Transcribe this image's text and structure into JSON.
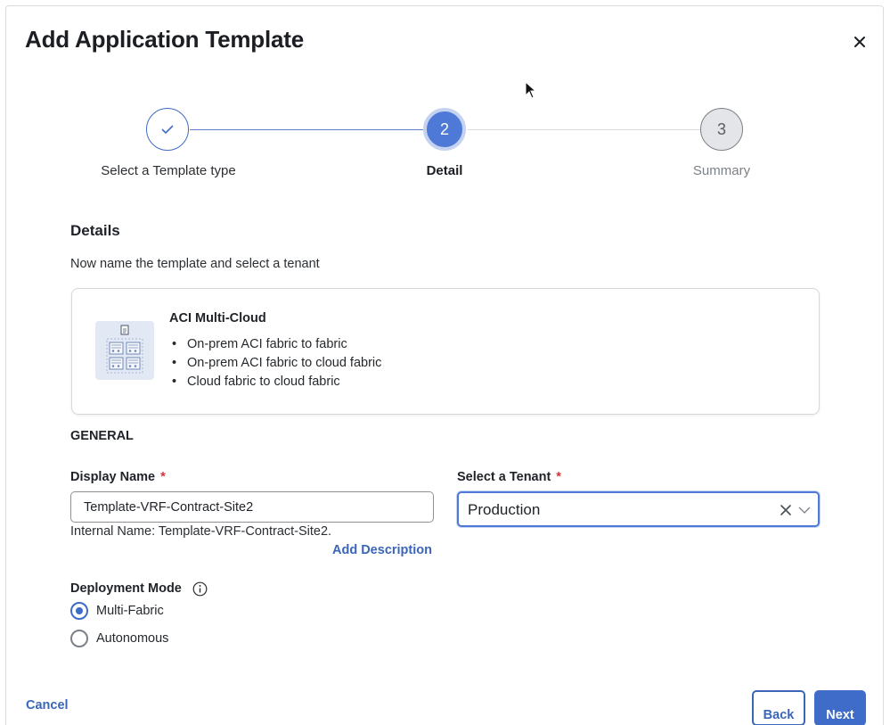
{
  "modal": {
    "title": "Add Application Template"
  },
  "stepper": {
    "steps": [
      {
        "number": "1",
        "label": "Select a Template type",
        "state": "completed"
      },
      {
        "number": "2",
        "label": "Detail",
        "state": "active"
      },
      {
        "number": "3",
        "label": "Summary",
        "state": "upcoming"
      }
    ]
  },
  "details": {
    "heading": "Details",
    "description": "Now name the template and select a tenant"
  },
  "template_card": {
    "title": "ACI Multi-Cloud",
    "items": [
      "On-prem ACI fabric to fabric",
      "On-prem ACI fabric to cloud fabric",
      "Cloud fabric to cloud fabric"
    ]
  },
  "general": {
    "heading": "GENERAL",
    "display_name": {
      "label": "Display Name",
      "required_mark": "*",
      "value": "Template-VRF-Contract-Site2"
    },
    "internal_name": "Internal Name: Template-VRF-Contract-Site2.",
    "add_description": "Add Description",
    "tenant": {
      "label": "Select a Tenant",
      "required_mark": "*",
      "value": "Production"
    }
  },
  "deployment_mode": {
    "label": "Deployment Mode",
    "options": [
      {
        "label": "Multi-Fabric",
        "checked": true
      },
      {
        "label": "Autonomous",
        "checked": false
      }
    ]
  },
  "footer": {
    "cancel": "Cancel",
    "back": "Back",
    "next": "Next"
  },
  "colors": {
    "primary": "#3f6bc9",
    "link": "#3a66b8",
    "required": "#d0343b",
    "active_step": "#4f79d6"
  },
  "icons": {
    "close": "close-icon",
    "check": "check-icon",
    "template": "template-grid-icon",
    "clear": "clear-icon",
    "chevron": "chevron-down-icon",
    "info": "info-icon"
  }
}
